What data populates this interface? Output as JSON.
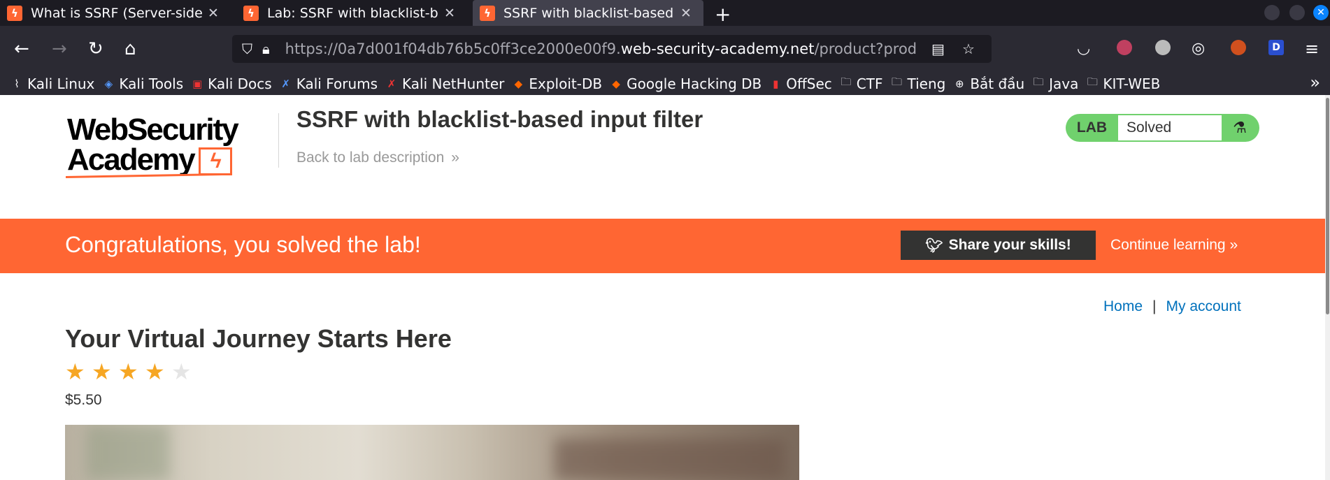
{
  "browser": {
    "tabs": [
      {
        "title": "What is SSRF (Server-side",
        "active": false
      },
      {
        "title": "Lab: SSRF with blacklist-b",
        "active": false
      },
      {
        "title": "SSRF with blacklist-based",
        "active": true
      }
    ],
    "url_prefix": "https://0a7d001f04db76b5c0ff3ce2000e00f9.",
    "url_domain": "web-security-academy.net",
    "url_path": "/product?prod",
    "bookmarks": [
      "Kali Linux",
      "Kali Tools",
      "Kali Docs",
      "Kali Forums",
      "Kali NetHunter",
      "Exploit-DB",
      "Google Hacking DB",
      "OffSec",
      "CTF",
      "Tieng",
      "Bắt đầu",
      "Java",
      "KIT-WEB"
    ],
    "accent_color": "#0a84ff"
  },
  "header": {
    "logo_line1": "WebSecurity",
    "logo_line2": "Academy",
    "lab_title": "SSRF with blacklist-based input filter",
    "back_link": "Back to lab description",
    "lab_label": "LAB",
    "lab_status": "Solved",
    "status_color": "#70d16d"
  },
  "banner": {
    "message": "Congratulations, you solved the lab!",
    "share_label": "Share your skills!",
    "continue_label": "Continue learning",
    "color": "#ff6633"
  },
  "nav": {
    "home": "Home",
    "separator": "|",
    "account": "My account"
  },
  "product": {
    "title": "Your Virtual Journey Starts Here",
    "rating": 4,
    "rating_max": 5,
    "price": "$5.50"
  }
}
